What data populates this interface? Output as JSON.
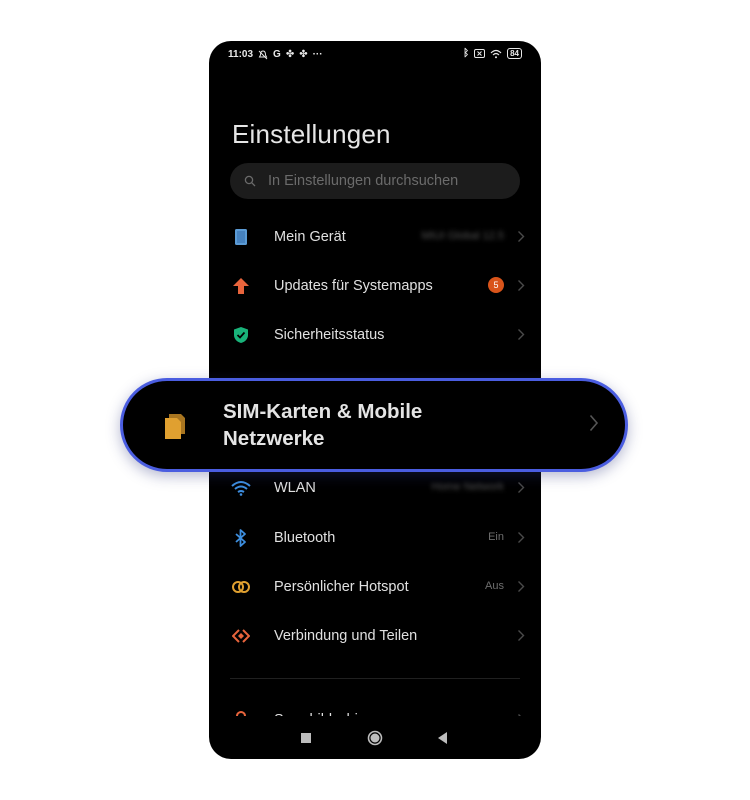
{
  "status_bar": {
    "time": "11:03",
    "left_icons": [
      "bell-off-icon",
      "google-icon",
      "fan-icon",
      "fan-icon",
      "more-dots-icon"
    ],
    "right_icons": [
      "bluetooth-icon",
      "sim-x-icon",
      "wifi-icon"
    ],
    "battery": "84"
  },
  "header": {
    "title": "Einstellungen"
  },
  "search": {
    "placeholder": "In Einstellungen durchsuchen"
  },
  "items": [
    {
      "label": "Mein Gerät",
      "value": "MIUI Global 12.5",
      "icon": "device-icon",
      "color": "#5b9bd5"
    },
    {
      "label": "Updates für Systemapps",
      "badge": "5",
      "icon": "update-arrow-icon",
      "color": "#e8643c"
    },
    {
      "label": "Sicherheitsstatus",
      "icon": "shield-check-icon",
      "color": "#19b37a"
    },
    {
      "label": "WLAN",
      "value": "Home Network",
      "icon": "wifi-icon",
      "color": "#3e8fe0"
    },
    {
      "label": "Bluetooth",
      "value": "Ein",
      "icon": "bluetooth-icon",
      "color": "#3e8fe0"
    },
    {
      "label": "Persönlicher Hotspot",
      "value": "Aus",
      "icon": "hotspot-icon",
      "color": "#e0a030"
    },
    {
      "label": "Verbindung und Teilen",
      "icon": "connection-share-icon",
      "color": "#e8643c"
    },
    {
      "label": "Sperrbildschirm",
      "icon": "lock-icon",
      "color": "#e8643c"
    }
  ],
  "highlight": {
    "label_line1": "SIM-Karten & Mobile",
    "label_line2": "Netzwerke",
    "icon": "sim-card-icon",
    "color": "#e0a030",
    "border_color": "#4a5de0"
  },
  "nav": [
    "recents-button",
    "home-button",
    "back-button"
  ]
}
